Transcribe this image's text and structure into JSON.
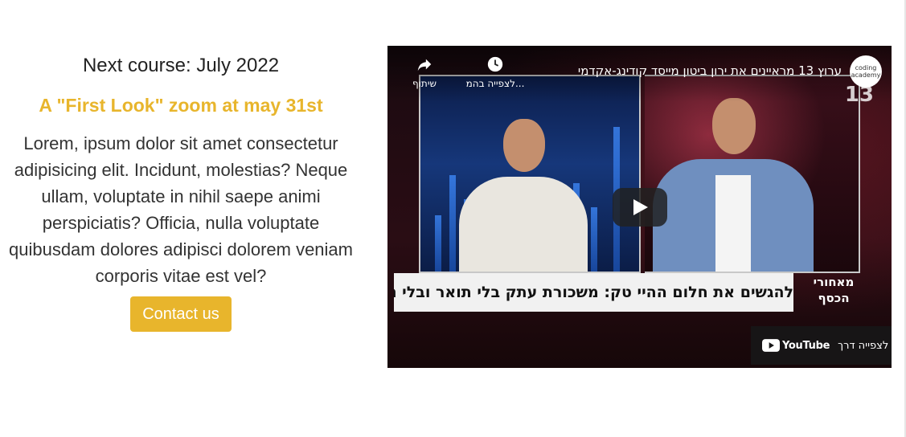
{
  "course": {
    "heading": "Next course: July 2022",
    "subheading": "A \"First Look\" zoom at may 31st",
    "body": "Lorem, ipsum dolor sit amet consectetur adipisicing elit. Incidunt, molestias? Neque ullam, voluptate in nihil saepe animi perspiciatis? Officia, nulla voluptate quibusdam dolores adipisci dolorem veniam corporis vitae est vel?",
    "contact_label": "Contact us"
  },
  "video": {
    "title": "ערוץ 13 מראיינים את ירון ביטון מייסד קודינג-אקדמי",
    "share_label": "שיתוף",
    "watch_later_label": "לצפייה בהמ...",
    "channel_avatar_text": "coding academy",
    "channel_number": "13",
    "lower_third": "להגשים את חלום ההיי טק: משכורת עתק בלי תואר ובלי ניסיון",
    "show_logo": "מאחורי הכסף",
    "watch_on_label": "לצפייה דרך",
    "youtube_label": "YouTube"
  },
  "colors": {
    "accent": "#e8b52c",
    "heading": "#222222",
    "text": "#333333"
  }
}
